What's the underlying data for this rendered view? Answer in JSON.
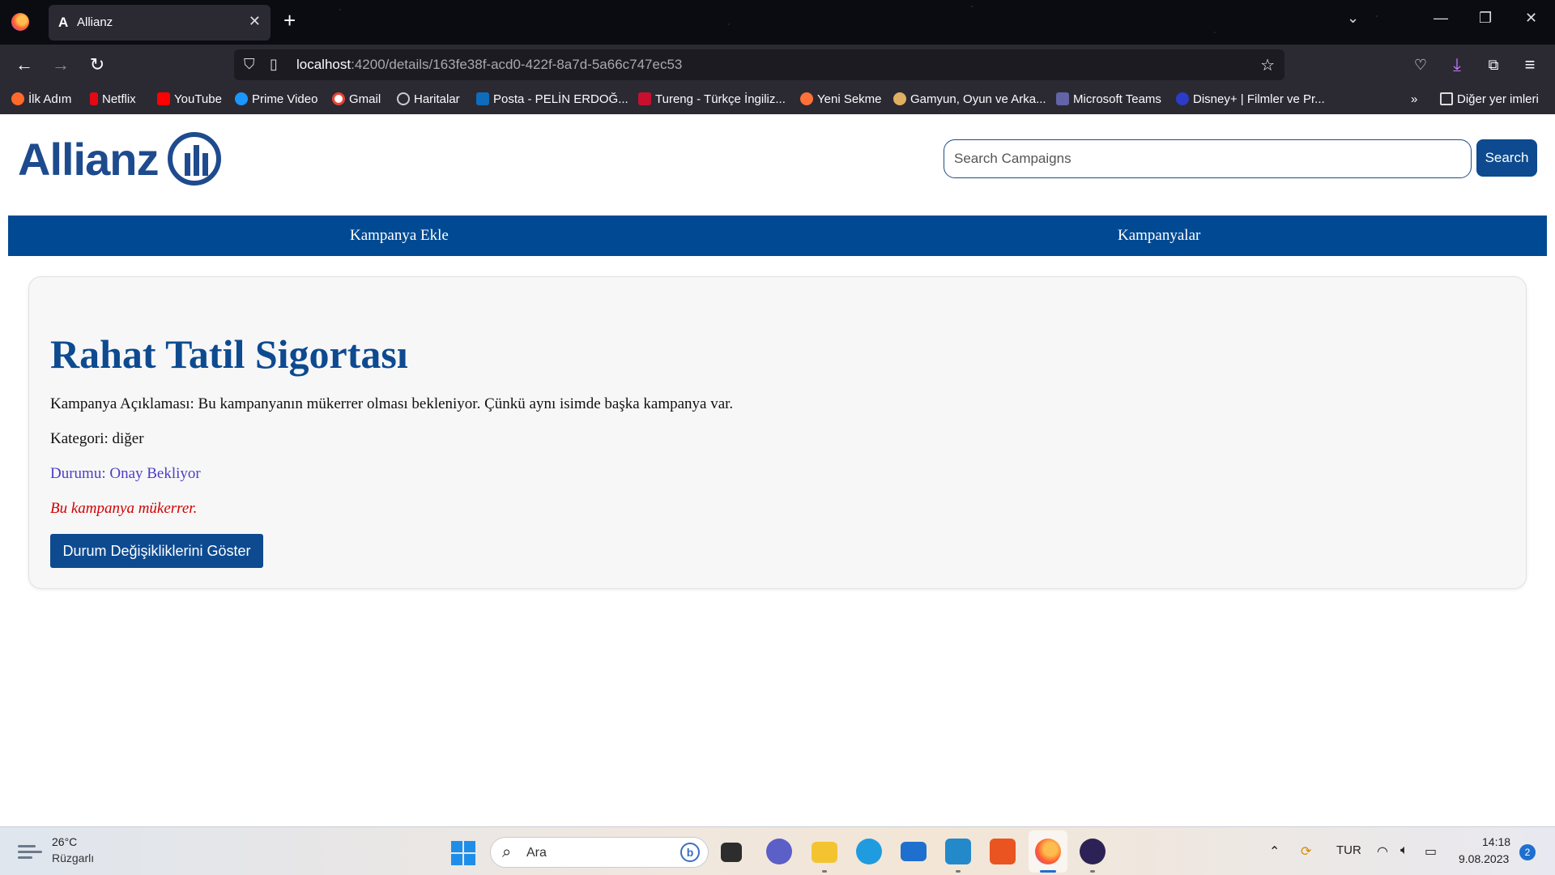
{
  "browser": {
    "tab_title": "Allianz",
    "url_host": "localhost",
    "url_path": ":4200/details/163fe38f-acd0-422f-8a7d-5a66c747ec53",
    "bookmarks": [
      {
        "label": "İlk Adım",
        "color": "#ff6a2b"
      },
      {
        "label": "Netflix",
        "color": "#e50914"
      },
      {
        "label": "YouTube",
        "color": "#ff0000"
      },
      {
        "label": "Prime Video",
        "color": "#1a98ff"
      },
      {
        "label": "Gmail",
        "color": "#ea4335"
      },
      {
        "label": "Haritalar",
        "color": "#bbbbbb"
      },
      {
        "label": "Posta - PELİN ERDOĞ...",
        "color": "#0f6cbd"
      },
      {
        "label": "Tureng - Türkçe İngiliz...",
        "color": "#c8102e"
      },
      {
        "label": "Yeni Sekme",
        "color": "#ff7139"
      },
      {
        "label": "Gamyun, Oyun ve Arka...",
        "color": "#e0b060"
      },
      {
        "label": "Microsoft Teams",
        "color": "#6264a7"
      },
      {
        "label": "Disney+ | Filmler ve Pr...",
        "color": "#2c3cc8"
      }
    ],
    "other_bookmarks": "Diğer yer imleri"
  },
  "header": {
    "logo_text": "Allianz",
    "search_placeholder": "Search Campaigns",
    "search_button": "Search"
  },
  "nav": {
    "items": [
      "Kampanya Ekle",
      "Kampanyalar"
    ]
  },
  "campaign": {
    "title": "Rahat Tatil Sigortası",
    "description": "Kampanya Açıklaması: Bu kampanyanın mükerrer olması bekleniyor. Çünkü aynı isimde başka kampanya var.",
    "category": "Kategori: diğer",
    "status": "Durumu: Onay Bekliyor",
    "duplicate_warning": "Bu kampanya mükerrer.",
    "history_button": "Durum Değişikliklerini Göster"
  },
  "taskbar": {
    "temperature": "26°C",
    "weather": "Rüzgarlı",
    "search_placeholder": "Ara",
    "language": "TUR",
    "time": "14:18",
    "date": "9.08.2023",
    "notifications": "2"
  },
  "colors": {
    "brand": "#0d4a90",
    "nav_bg": "#014a93",
    "status": "#4b3fc6",
    "warning": "#d20000"
  }
}
